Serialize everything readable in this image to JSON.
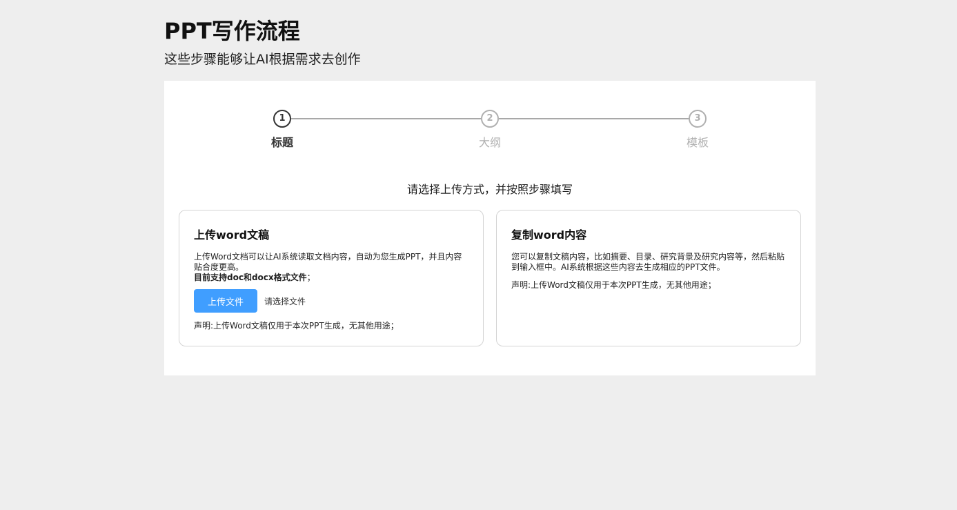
{
  "header": {
    "title": "PPT写作流程",
    "subtitle": "这些步骤能够让AI根据需求去创作"
  },
  "stepper": {
    "active_index": 0,
    "steps": [
      {
        "number": "1",
        "label": "标题"
      },
      {
        "number": "2",
        "label": "大纲"
      },
      {
        "number": "3",
        "label": "模板"
      }
    ]
  },
  "main": {
    "instruction": "请选择上传方式，并按照步骤填写",
    "upload_card": {
      "title": "上传word文稿",
      "description": "上传Word文档可以让AI系统读取文档内容，自动为您生成PPT，并且内容贴合度更高。",
      "support_text": "目前支持doc和docx格式文件",
      "support_suffix": "；",
      "upload_button_label": "上传文件",
      "file_hint": "请选择文件",
      "disclaimer": "声明:上传Word文稿仅用于本次PPT生成，无其他用途；"
    },
    "paste_card": {
      "title": "复制word内容",
      "description": "您可以复制文稿内容，比如摘要、目录、研究背景及研究内容等，然后粘贴到输入框中。AI系统根据这些内容去生成相应的PPT文件。",
      "disclaimer": "声明:上传Word文稿仅用于本次PPT生成，无其他用途；"
    }
  },
  "colors": {
    "accent": "#409eff",
    "background": "#eeeeee",
    "inactive_step": "#b0b0b0",
    "active_step": "#333333"
  }
}
